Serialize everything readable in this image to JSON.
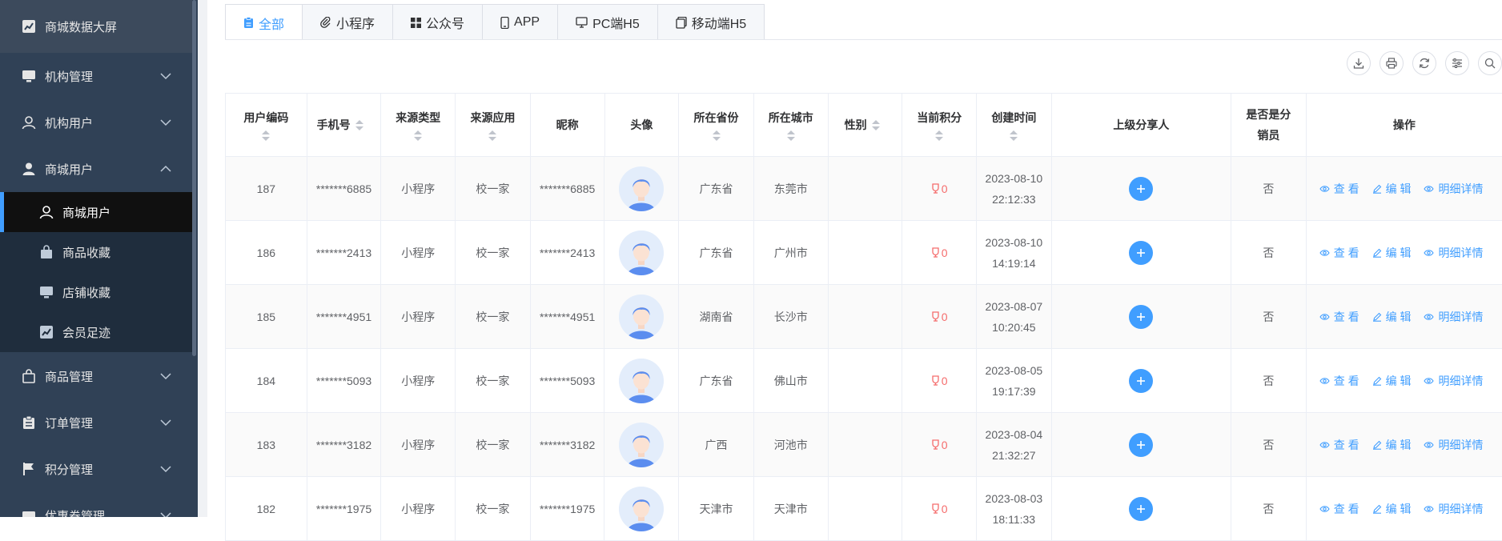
{
  "sidebar": {
    "top": "商城数据大屏",
    "items": [
      {
        "label": "机构管理"
      },
      {
        "label": "机构用户"
      },
      {
        "label": "商城用户"
      },
      {
        "label": "商城用户"
      },
      {
        "label": "商品收藏"
      },
      {
        "label": "店铺收藏"
      },
      {
        "label": "会员足迹"
      },
      {
        "label": "商品管理"
      },
      {
        "label": "订单管理"
      },
      {
        "label": "积分管理"
      },
      {
        "label": "优惠券管理"
      }
    ]
  },
  "tabs": [
    "全部",
    "小程序",
    "公众号",
    "APP",
    "PC端H5",
    "移动端H5"
  ],
  "table": {
    "headers": [
      "用户编码",
      "手机号",
      "来源类型",
      "来源应用",
      "昵称",
      "头像",
      "所在省份",
      "所在城市",
      "性别",
      "当前积分",
      "创建时间",
      "上级分享人",
      "是否是分销员",
      "操作"
    ],
    "actions": [
      "查 看",
      "编 辑",
      "明细详情"
    ],
    "rows": [
      {
        "id": "187",
        "phone": "*******6885",
        "type": "小程序",
        "app": "校一家",
        "nick": "*******6885",
        "prov": "广东省",
        "city": "东莞市",
        "gender": "",
        "points": "0",
        "date": "2023-08-10",
        "time": "22:12:33",
        "dist": "否"
      },
      {
        "id": "186",
        "phone": "*******2413",
        "type": "小程序",
        "app": "校一家",
        "nick": "*******2413",
        "prov": "广东省",
        "city": "广州市",
        "gender": "",
        "points": "0",
        "date": "2023-08-10",
        "time": "14:19:14",
        "dist": "否"
      },
      {
        "id": "185",
        "phone": "*******4951",
        "type": "小程序",
        "app": "校一家",
        "nick": "*******4951",
        "prov": "湖南省",
        "city": "长沙市",
        "gender": "",
        "points": "0",
        "date": "2023-08-07",
        "time": "10:20:45",
        "dist": "否"
      },
      {
        "id": "184",
        "phone": "*******5093",
        "type": "小程序",
        "app": "校一家",
        "nick": "*******5093",
        "prov": "广东省",
        "city": "佛山市",
        "gender": "",
        "points": "0",
        "date": "2023-08-05",
        "time": "19:17:39",
        "dist": "否"
      },
      {
        "id": "183",
        "phone": "*******3182",
        "type": "小程序",
        "app": "校一家",
        "nick": "*******3182",
        "prov": "广西",
        "city": "河池市",
        "gender": "",
        "points": "0",
        "date": "2023-08-04",
        "time": "21:32:27",
        "dist": "否"
      },
      {
        "id": "182",
        "phone": "*******1975",
        "type": "小程序",
        "app": "校一家",
        "nick": "*******1975",
        "prov": "天津市",
        "city": "天津市",
        "gender": "",
        "points": "0",
        "date": "2023-08-03",
        "time": "18:11:33",
        "dist": "否"
      }
    ]
  },
  "colors": {
    "sidebar_bg": "#304156",
    "accent": "#409eff",
    "points": "#f56c6c"
  }
}
